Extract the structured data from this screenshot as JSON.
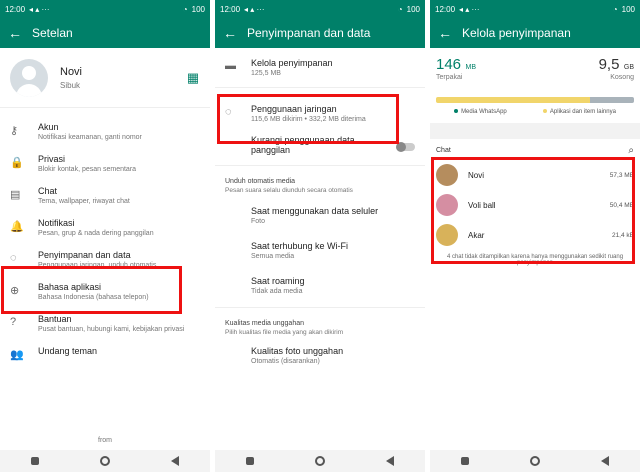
{
  "status": {
    "time": "12:00",
    "battery": "100"
  },
  "panel1": {
    "title": "Setelan",
    "profile": {
      "name": "Novi",
      "status": "Sibuk"
    },
    "items": [
      {
        "icon": "key-icon",
        "glyph": "⚷",
        "title": "Akun",
        "subtitle": "Notifikasi keamanan, ganti nomor"
      },
      {
        "icon": "lock-icon",
        "glyph": "🔒",
        "title": "Privasi",
        "subtitle": "Blokir kontak, pesan sementara"
      },
      {
        "icon": "chat-icon",
        "glyph": "▤",
        "title": "Chat",
        "subtitle": "Tema, wallpaper, riwayat chat"
      },
      {
        "icon": "bell-icon",
        "glyph": "🔔",
        "title": "Notifikasi",
        "subtitle": "Pesan, grup & nada dering panggilan"
      },
      {
        "icon": "storage-icon",
        "glyph": "◌",
        "title": "Penyimpanan dan data",
        "subtitle": "Penggunaan jaringan, unduh otomatis"
      },
      {
        "icon": "globe-icon",
        "glyph": "⊕",
        "title": "Bahasa aplikasi",
        "subtitle": "Bahasa Indonesia (bahasa telepon)"
      },
      {
        "icon": "help-icon",
        "glyph": "?",
        "title": "Bantuan",
        "subtitle": "Pusat bantuan, hubungi kami, kebijakan privasi"
      },
      {
        "icon": "people-icon",
        "glyph": "👥",
        "title": "Undang teman",
        "subtitle": ""
      }
    ],
    "from": "from"
  },
  "panel2": {
    "title": "Penyimpanan dan data",
    "manage": {
      "title": "Kelola penyimpanan",
      "subtitle": "125,5 MB"
    },
    "usage": {
      "title": "Penggunaan jaringan",
      "subtitle": "115,6 MB dikirim • 332,2 MB diterima"
    },
    "reduce": {
      "title": "Kurangi penggunaan data panggilan"
    },
    "auto": {
      "title": "Unduh otomatis media",
      "subtitle": "Pesan suara selalu diunduh secara otomatis"
    },
    "auto_items": [
      {
        "title": "Saat menggunakan data seluler",
        "subtitle": "Foto"
      },
      {
        "title": "Saat terhubung ke Wi-Fi",
        "subtitle": "Semua media"
      },
      {
        "title": "Saat roaming",
        "subtitle": "Tidak ada media"
      }
    ],
    "quality": {
      "title": "Kualitas media unggahan",
      "subtitle": "Pilih kualitas file media yang akan dikirim"
    },
    "photo": {
      "title": "Kualitas foto unggahan",
      "subtitle": "Otomatis (disarankan)"
    }
  },
  "panel3": {
    "title": "Kelola penyimpanan",
    "used": {
      "value": "146",
      "unit": "MB",
      "label": "Terpakai"
    },
    "free": {
      "value": "9,5",
      "unit": "GB",
      "label": "Kosong"
    },
    "legend": [
      "Media WhatsApp",
      "Aplikasi dan item lainnya"
    ],
    "colors": {
      "whatsapp": "#f1d56b",
      "other": "#a9b3ba",
      "free": "#e6e6e6"
    },
    "chat_header": "Chat",
    "chats": [
      {
        "name": "Novi",
        "size": "57,3 MB",
        "color": "#b58d5e"
      },
      {
        "name": "Voli ball",
        "size": "50,4 MB",
        "color": "#d58ea2"
      },
      {
        "name": "Akar",
        "size": "21,4 kB",
        "color": "#d8b25a"
      }
    ],
    "note": "4 chat tidak ditampilkan karena hanya menggunakan sedikit ruang penyimpanan"
  }
}
